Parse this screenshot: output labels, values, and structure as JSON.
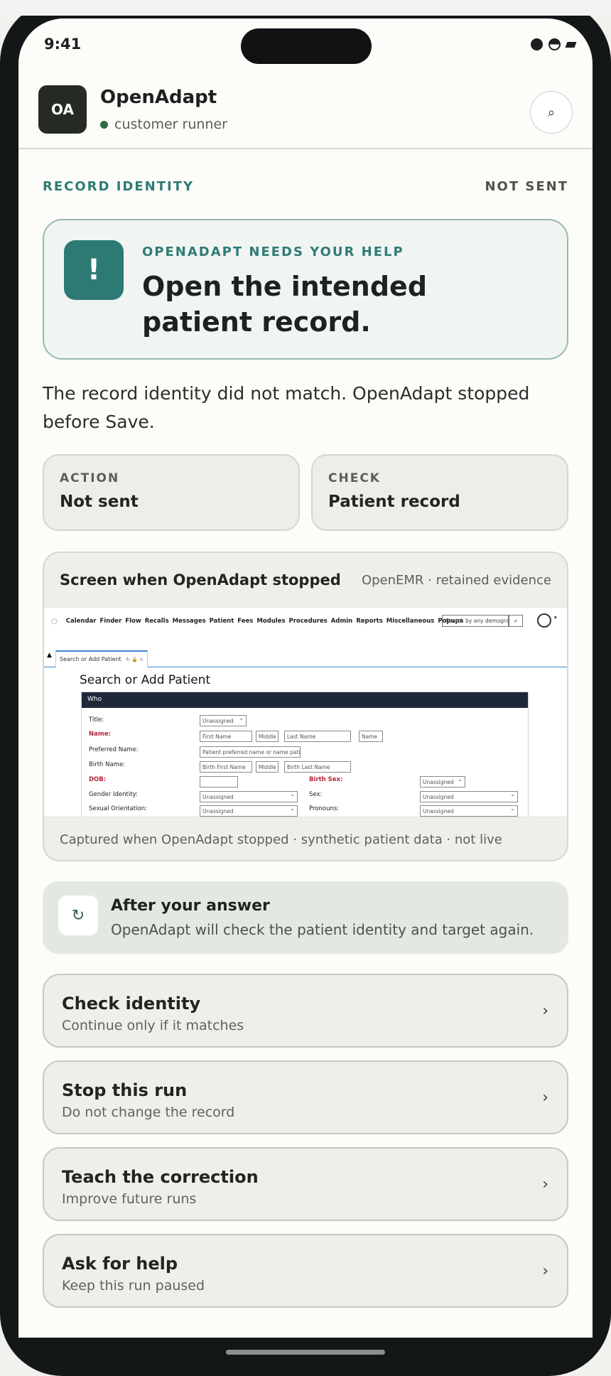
{
  "status_bar": {
    "time": "9:41"
  },
  "header": {
    "avatar_initials": "OA",
    "app_name": "OpenAdapt",
    "subtitle": "customer runner",
    "search_icon": "search-icon"
  },
  "section": {
    "label": "RECORD IDENTITY",
    "status": "NOT SENT"
  },
  "alert": {
    "kicker": "OPENADAPT NEEDS YOUR HELP",
    "title": "Open the intended patient record.",
    "icon": "!"
  },
  "explanation": "The record identity did not match. OpenAdapt stopped before Save.",
  "info_cards": [
    {
      "label": "ACTION",
      "value": "Not sent"
    },
    {
      "label": "CHECK",
      "value": "Patient record"
    }
  ],
  "evidence": {
    "title": "Screen when OpenAdapt stopped",
    "meta": "OpenEMR · retained evidence",
    "footer": "Captured when OpenAdapt stopped · synthetic patient data · not live",
    "emr": {
      "menu": [
        "Calendar",
        "Finder",
        "Flow",
        "Recalls",
        "Messages",
        "Patient",
        "Fees",
        "Modules",
        "Procedures",
        "Admin",
        "Reports",
        "Miscellaneous",
        "Popups"
      ],
      "search_placeholder": "Search by any demograph",
      "tab_label": "Search or Add Patient",
      "tab_icons": "↻ 🔒 ×",
      "page_title": "Search or Add Patient",
      "panel_title": "Who",
      "fields": {
        "title_label": "Title:",
        "title_value": "Unassigned",
        "name_label": "Name:",
        "first_name": "First Name",
        "middle": "Middle",
        "last_name": "Last Name",
        "name_suffix": "Name",
        "preferred_label": "Preferred Name:",
        "preferred_placeholder": "Patient preferred name or name patient",
        "birth_name_label": "Birth Name:",
        "birth_first_name": "Birth First Name",
        "birth_middle": "Middle",
        "birth_last_name": "Birth Last Name",
        "dob_label": "DOB:",
        "birth_sex_label": "Birth Sex:",
        "birth_sex_value": "Unassigned",
        "gender_label": "Gender Identity:",
        "gender_value": "Unassigned",
        "sex_label": "Sex:",
        "sex_value": "Unassigned",
        "orientation_label": "Sexual Orientation:",
        "orientation_value": "Unassigned",
        "pronouns_label": "Pronouns:",
        "pronouns_value": "Unassigned"
      }
    }
  },
  "after": {
    "title": "After your answer",
    "text": "OpenAdapt will check the patient identity and target again.",
    "icon": "↻"
  },
  "choices": [
    {
      "title": "Check identity",
      "subtitle": "Continue only if it matches"
    },
    {
      "title": "Stop this run",
      "subtitle": "Do not change the record"
    },
    {
      "title": "Teach the correction",
      "subtitle": "Improve future runs"
    },
    {
      "title": "Ask for help",
      "subtitle": "Keep this run paused"
    }
  ],
  "chevron": "›",
  "colors": {
    "accent": "#2d7a74",
    "online": "#2e6a48",
    "required": "#b2253a"
  }
}
